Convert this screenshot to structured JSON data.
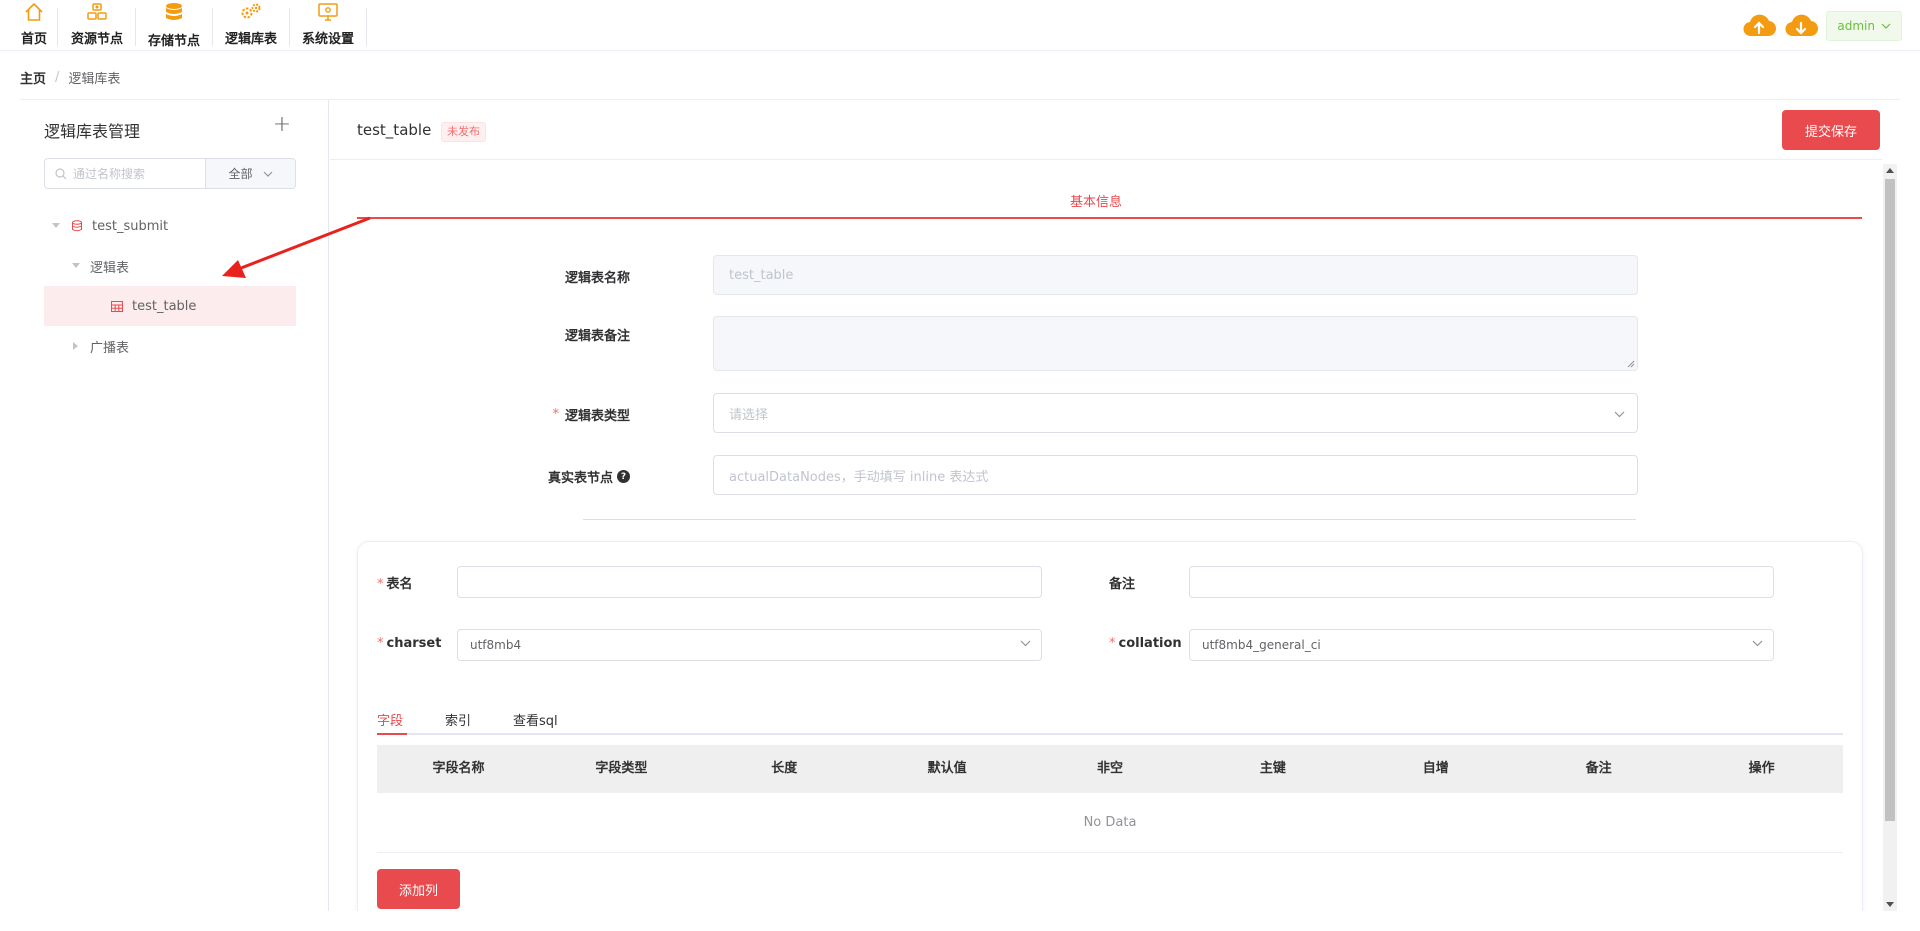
{
  "nav": {
    "items": [
      {
        "label": "首页",
        "icon": "home-icon"
      },
      {
        "label": "资源节点",
        "icon": "resource-nodes-icon"
      },
      {
        "label": "存储节点",
        "icon": "storage-database-icon"
      },
      {
        "label": "逻辑库表",
        "icon": "gears-icon"
      },
      {
        "label": "系统设置",
        "icon": "monitor-settings-icon"
      }
    ],
    "upload_icon": "cloud-upload-icon",
    "download_icon": "cloud-download-icon",
    "user": "admin",
    "accent_color": "#f39c12"
  },
  "breadcrumb": {
    "home": "主页",
    "separator": "/",
    "current": "逻辑库表"
  },
  "sidebar": {
    "title": "逻辑库表管理",
    "search_placeholder": "通过名称搜索",
    "filter_value": "全部",
    "tree": {
      "database": "test_submit",
      "group_logical": "逻辑表",
      "selected_table": "test_table",
      "group_broadcast": "广播表"
    }
  },
  "header": {
    "title": "test_table",
    "status_tag": "未发布",
    "submit_label": "提交保存"
  },
  "basic": {
    "section_title": "基本信息",
    "name_label": "逻辑表名称",
    "name_value": "test_table",
    "remark_label": "逻辑表备注",
    "type_label": "逻辑表类型",
    "type_placeholder": "请选择",
    "nodes_label": "真实表节点",
    "nodes_placeholder": "actualDataNodes，手动填写 inline 表达式"
  },
  "table_form": {
    "name_label": "表名",
    "remark_label": "备注",
    "charset_label": "charset",
    "charset_value": "utf8mb4",
    "collation_label": "collation",
    "collation_value": "utf8mb4_general_ci",
    "tabs": [
      "字段",
      "索引",
      "查看sql"
    ],
    "active_tab": 0,
    "columns": [
      "字段名称",
      "字段类型",
      "长度",
      "默认值",
      "非空",
      "主键",
      "自增",
      "备注",
      "操作"
    ],
    "empty_text": "No Data",
    "add_column_label": "添加列"
  },
  "colors": {
    "primary": "#e84a4e",
    "required": "#f56c6c",
    "admin_green": "#67c23a"
  }
}
